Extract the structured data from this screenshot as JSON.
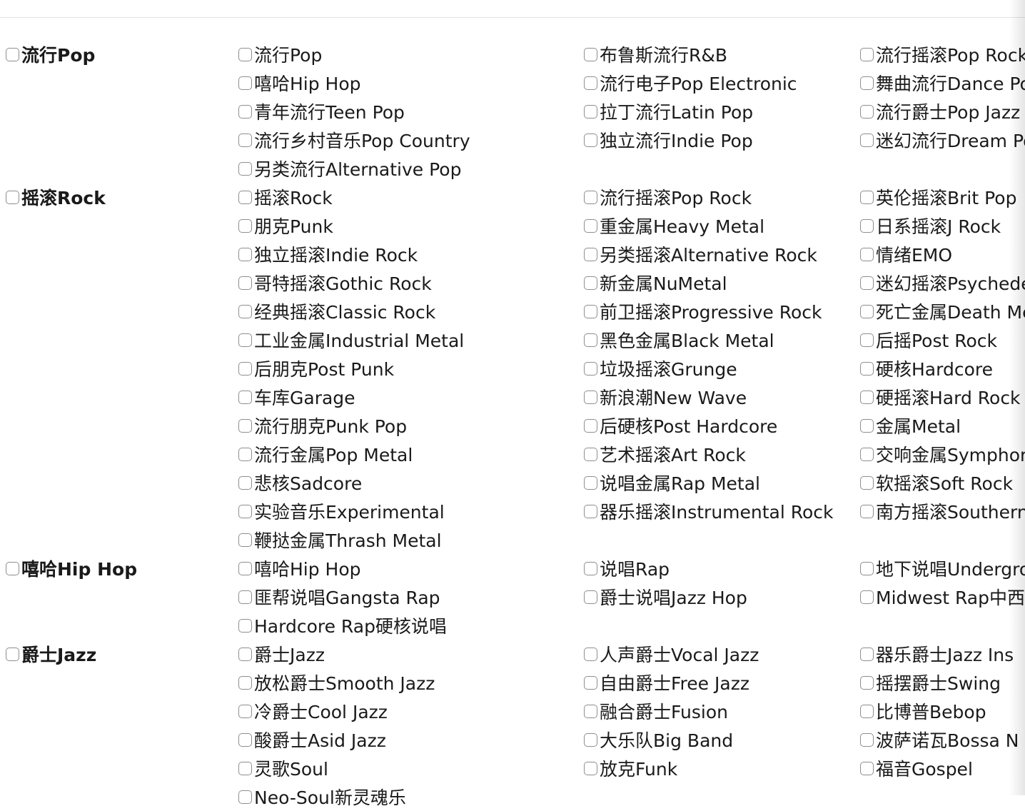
{
  "groups": [
    {
      "label": "流行Pop",
      "items": [
        "流行Pop",
        "布鲁斯流行R&B",
        "流行摇滚Pop Rock",
        "嘻哈Hip Hop",
        "流行电子Pop Electronic",
        "舞曲流行Dance Pop",
        "青年流行Teen Pop",
        "拉丁流行Latin Pop",
        "流行爵士Pop Jazz",
        "流行乡村音乐Pop Country",
        "独立流行Indie Pop",
        "迷幻流行Dream Pop",
        "另类流行Alternative Pop"
      ]
    },
    {
      "label": "摇滚Rock",
      "items": [
        "摇滚Rock",
        "流行摇滚Pop Rock",
        "英伦摇滚Brit Pop",
        "朋克Punk",
        "重金属Heavy Metal",
        "日系摇滚J Rock",
        "独立摇滚Indie Rock",
        "另类摇滚Alternative Rock",
        "情绪EMO",
        "哥特摇滚Gothic Rock",
        "新金属NuMetal",
        "迷幻摇滚Psychedelic",
        "经典摇滚Classic Rock",
        "前卫摇滚Progressive Rock",
        "死亡金属Death Metal",
        "工业金属Industrial Metal",
        "黑色金属Black Metal",
        "后摇Post Rock",
        "后朋克Post Punk",
        "垃圾摇滚Grunge",
        "硬核Hardcore",
        "车库Garage",
        "新浪潮New Wave",
        "硬摇滚Hard Rock",
        "流行朋克Punk Pop",
        "后硬核Post Hardcore",
        "金属Metal",
        "流行金属Pop Metal",
        "艺术摇滚Art Rock",
        "交响金属Symphonic",
        "悲核Sadcore",
        "说唱金属Rap Metal",
        "软摇滚Soft Rock",
        "实验音乐Experimental",
        "器乐摇滚Instrumental Rock",
        "南方摇滚Southern",
        "鞭挞金属Thrash Metal"
      ]
    },
    {
      "label": "嘻哈Hip Hop",
      "items": [
        "嘻哈Hip Hop",
        "说唱Rap",
        "地下说唱Underground",
        "匪帮说唱Gangsta Rap",
        "爵士说唱Jazz Hop",
        "Midwest Rap中西",
        "Hardcore Rap硬核说唱"
      ]
    },
    {
      "label": "爵士Jazz",
      "items": [
        "爵士Jazz",
        "人声爵士Vocal Jazz",
        "器乐爵士Jazz Ins",
        "放松爵士Smooth Jazz",
        "自由爵士Free Jazz",
        "摇摆爵士Swing",
        "冷爵士Cool Jazz",
        "融合爵士Fusion",
        "比博普Bebop",
        "酸爵士Asid Jazz",
        "大乐队Big Band",
        "波萨诺瓦Bossa N",
        "灵歌Soul",
        "放克Funk",
        "福音Gospel",
        "Neo-Soul新灵魂乐"
      ]
    }
  ]
}
